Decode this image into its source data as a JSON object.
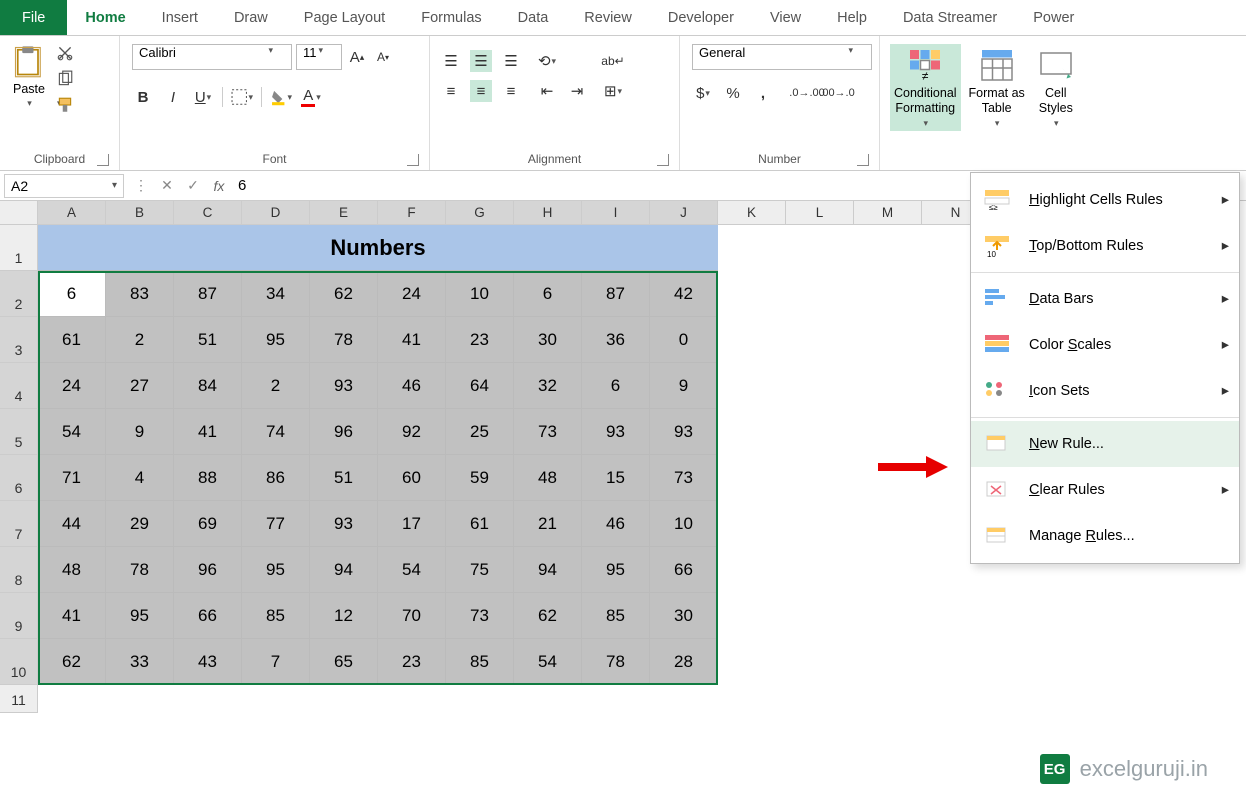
{
  "tabs": {
    "file": "File",
    "items": [
      "Home",
      "Insert",
      "Draw",
      "Page Layout",
      "Formulas",
      "Data",
      "Review",
      "Developer",
      "View",
      "Help",
      "Data Streamer",
      "Power"
    ],
    "active": "Home"
  },
  "ribbon": {
    "clipboard": {
      "label": "Clipboard",
      "paste": "Paste"
    },
    "font": {
      "label": "Font",
      "name": "Calibri",
      "size": "11"
    },
    "alignment": {
      "label": "Alignment"
    },
    "number": {
      "label": "Number",
      "format": "General"
    },
    "styles": {
      "conditional": "Conditional\nFormatting",
      "formatAs": "Format as\nTable",
      "cellStyles": "Cell\nStyles"
    }
  },
  "cf_menu": {
    "highlight": "Highlight Cells Rules",
    "topbottom": "Top/Bottom Rules",
    "databars": "Data Bars",
    "colorscales": "Color Scales",
    "iconsets": "Icon Sets",
    "newrule": "New Rule...",
    "clearrules": "Clear Rules",
    "managerules": "Manage Rules..."
  },
  "name_box": "A2",
  "formula_value": "6",
  "columns": [
    "A",
    "B",
    "C",
    "D",
    "E",
    "F",
    "G",
    "H",
    "I",
    "J",
    "K",
    "L",
    "M",
    "N"
  ],
  "header_title": "Numbers",
  "grid": [
    [
      6,
      83,
      87,
      34,
      62,
      24,
      10,
      6,
      87,
      42
    ],
    [
      61,
      2,
      51,
      95,
      78,
      41,
      23,
      30,
      36,
      0
    ],
    [
      24,
      27,
      84,
      2,
      93,
      46,
      64,
      32,
      6,
      9
    ],
    [
      54,
      9,
      41,
      74,
      96,
      92,
      25,
      73,
      93,
      93
    ],
    [
      71,
      4,
      88,
      86,
      51,
      60,
      59,
      48,
      15,
      73
    ],
    [
      44,
      29,
      69,
      77,
      93,
      17,
      61,
      21,
      46,
      10
    ],
    [
      48,
      78,
      96,
      95,
      94,
      54,
      75,
      94,
      95,
      66
    ],
    [
      41,
      95,
      66,
      85,
      12,
      70,
      73,
      62,
      85,
      30
    ],
    [
      62,
      33,
      43,
      7,
      65,
      23,
      85,
      54,
      78,
      28
    ]
  ],
  "watermark": "excelguruji.in"
}
